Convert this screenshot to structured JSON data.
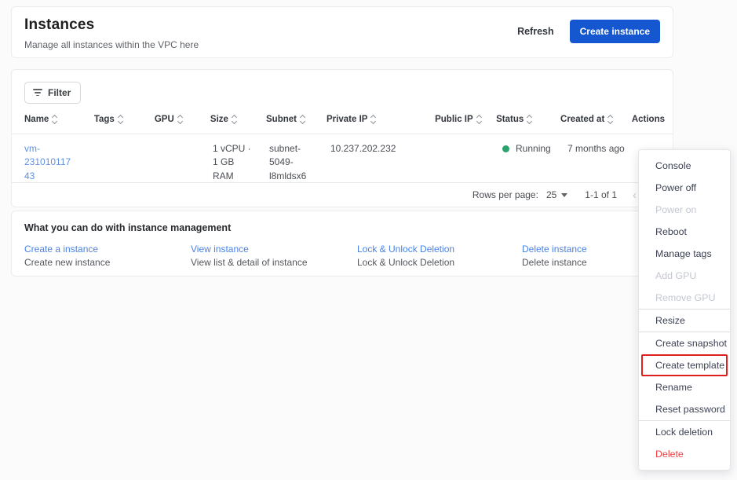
{
  "colors": {
    "accent_blue": "#1457d0",
    "link_blue": "#4a82e4",
    "name_link_blue": "#6190e2",
    "status_green": "#2aa36d",
    "danger_red": "#f23d3d",
    "highlight_box_red": "#e01f1f"
  },
  "header": {
    "title": "Instances",
    "subtitle": "Manage all instances within the VPC here",
    "refresh_label": "Refresh",
    "create_label": "Create instance"
  },
  "table": {
    "filter_label": "Filter",
    "columns": [
      "Name",
      "Tags",
      "GPU",
      "Size",
      "Subnet",
      "Private IP",
      "Public IP",
      "Status",
      "Created at",
      "Actions"
    ],
    "row": {
      "name": "vm-23101011743",
      "tags": "",
      "gpu": "",
      "size": "1 vCPU ·\n1 GB\nRAM",
      "subnet": "subnet-\n5049-\nl8mldsx6",
      "private_ip": "10.237.202.232",
      "public_ip": "",
      "status": "Running",
      "created_at": "7 months ago"
    },
    "pagination": {
      "rows_per_page_label": "Rows per page:",
      "rows_per_page_value": "25",
      "range": "1-1 of 1",
      "prev_icon": "‹"
    }
  },
  "info": {
    "title": "What you can do with instance management",
    "items": [
      {
        "link": "Create a instance",
        "desc": "Create new instance"
      },
      {
        "link": "View instance",
        "desc": "View list & detail of instance"
      },
      {
        "link": "Lock & Unlock Deletion",
        "desc": "Lock & Unlock Deletion"
      },
      {
        "link": "Delete instance",
        "desc": "Delete instance"
      }
    ]
  },
  "menu": {
    "items": [
      {
        "label": "Console"
      },
      {
        "label": "Power off"
      },
      {
        "label": "Power on",
        "disabled": true
      },
      {
        "label": "Reboot"
      },
      {
        "label": "Manage tags"
      },
      {
        "label": "Add GPU",
        "disabled": true
      },
      {
        "label": "Remove GPU",
        "disabled": true
      },
      {
        "label": "Resize"
      },
      {
        "label": "Create snapshot"
      },
      {
        "label": "Create template",
        "highlighted": true
      },
      {
        "label": "Rename"
      },
      {
        "label": "Reset password"
      },
      {
        "label": "Lock deletion"
      },
      {
        "label": "Delete",
        "danger": true
      }
    ]
  }
}
